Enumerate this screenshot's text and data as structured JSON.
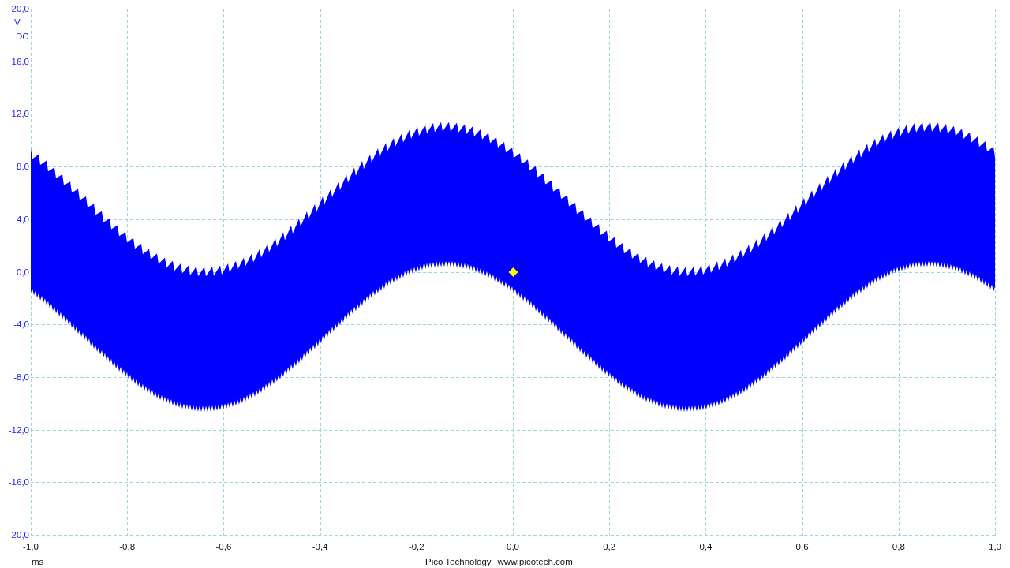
{
  "y_axis": {
    "ticks": [
      "20,0",
      "16,0",
      "12,0",
      "8,0",
      "4,0",
      "0,0",
      "-4,0",
      "-8,0",
      "-12,0",
      "-16,0",
      "-20,0"
    ],
    "unit": "V",
    "coupling": "DC"
  },
  "x_axis": {
    "ticks": [
      "-1,0",
      "-0,8",
      "-0,6",
      "-0,4",
      "-0,2",
      "0,0",
      "0,2",
      "0,4",
      "0,6",
      "0,8",
      "1,0"
    ],
    "unit": "ms"
  },
  "footer": {
    "company": "Pico Technology",
    "website": "www.picotech.com"
  }
}
